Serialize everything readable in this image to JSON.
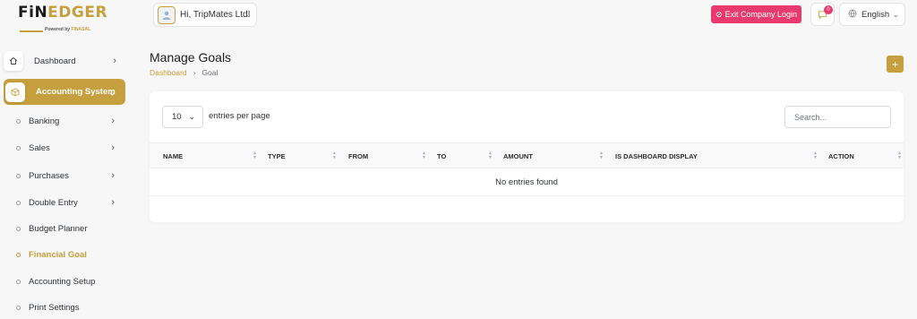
{
  "brand": {
    "logo_text_a": "FiN",
    "logo_text_b": "EDGER",
    "powered_by": "Powered by",
    "powered_brand": "FINASAL"
  },
  "header": {
    "greeting": "Hi, TripMates Ltd!",
    "exit_label": "Exit Company Login",
    "notification_count": "0",
    "language": "English"
  },
  "sidebar": {
    "dashboard": "Dashboard",
    "accounting_system": "Accounting System",
    "sub_items": [
      {
        "label": "Banking"
      },
      {
        "label": "Sales"
      },
      {
        "label": "Purchases"
      },
      {
        "label": "Double Entry"
      },
      {
        "label": "Budget Planner"
      },
      {
        "label": "Financial Goal"
      },
      {
        "label": "Accounting Setup"
      },
      {
        "label": "Print Settings"
      }
    ]
  },
  "page": {
    "title": "Manage Goals",
    "breadcrumb": [
      "Dashboard",
      "Goal"
    ],
    "add_label": "+"
  },
  "table": {
    "entries_value": "10",
    "entries_label": "entries per page",
    "search_placeholder": "Search...",
    "columns": [
      "Name",
      "Type",
      "From",
      "To",
      "Amount",
      "Is Dashboard Display",
      "Action"
    ],
    "empty_message": "No entries found"
  },
  "colors": {
    "accent": "#c6a03e",
    "danger": "#e83a6e"
  }
}
